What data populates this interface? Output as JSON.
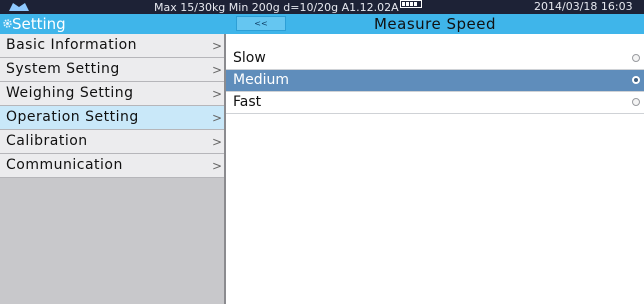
{
  "status_bar": {
    "info": "Max 15/30kg  Min 200g  d=10/20g   A1.12.02A",
    "date_time": "2014/03/18  16:03",
    "icons": [
      "scale-logo-icon",
      "battery-icon"
    ]
  },
  "sidebar": {
    "title": "Setting",
    "icon": "gear-icon",
    "items": [
      {
        "label": "Basic Information",
        "selected": false
      },
      {
        "label": "System Setting",
        "selected": false
      },
      {
        "label": "Weighing Setting",
        "selected": false
      },
      {
        "label": "Operation Setting",
        "selected": true
      },
      {
        "label": "Calibration",
        "selected": false
      },
      {
        "label": "Communication",
        "selected": false
      }
    ],
    "chevron": ">"
  },
  "panel": {
    "back_label": "<<",
    "title": "Measure Speed",
    "options": [
      {
        "label": "Slow",
        "selected": false
      },
      {
        "label": "Medium",
        "selected": true
      },
      {
        "label": "Fast",
        "selected": false
      }
    ]
  },
  "colors": {
    "header_blue": "#3fb5ea",
    "selected_option": "#5f8dbb",
    "selected_menu": "#c9e8f9",
    "status_bar": "#1d2236"
  }
}
